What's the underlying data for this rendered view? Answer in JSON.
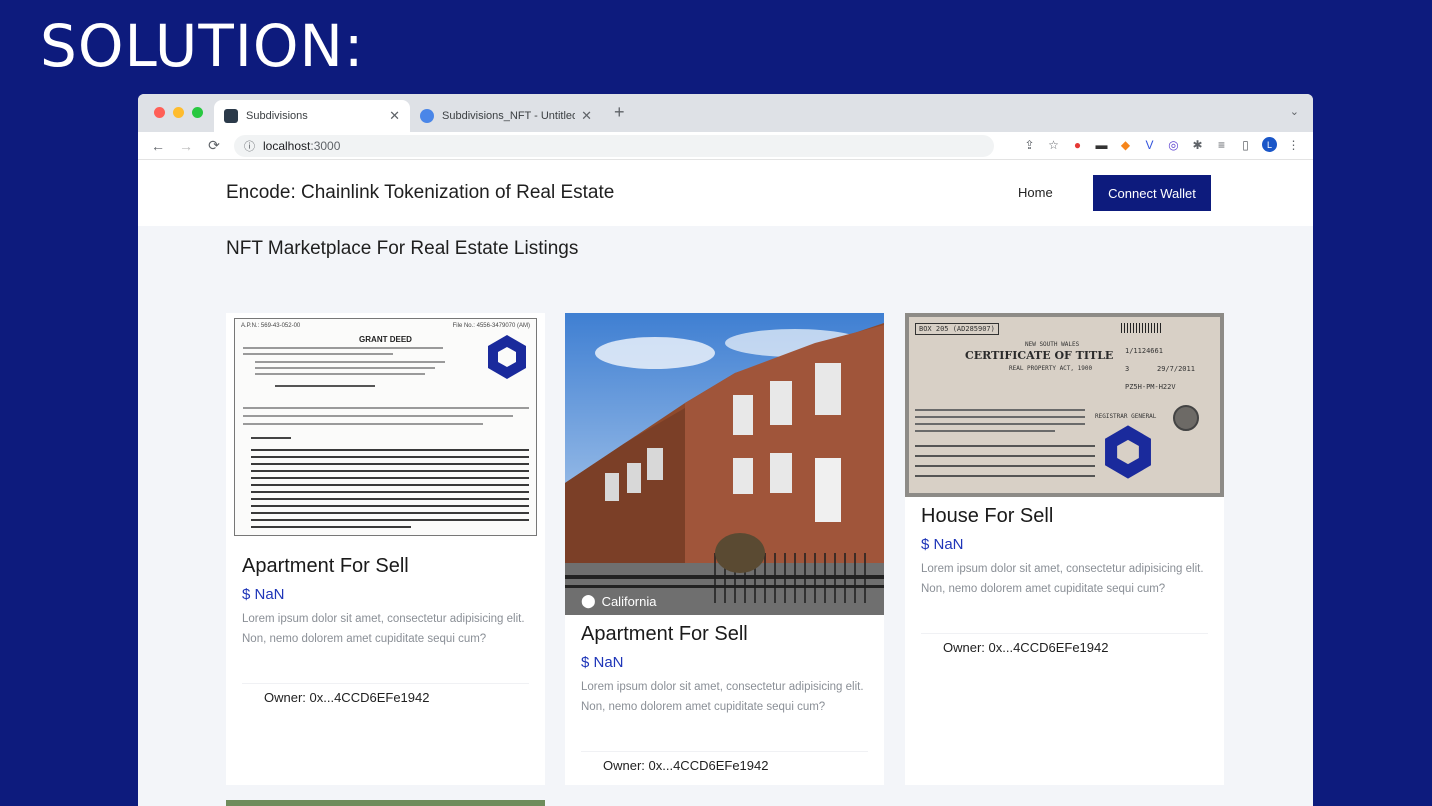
{
  "slide": {
    "title": "SOLUTION:"
  },
  "browser": {
    "tabs": [
      {
        "label": "Subdivisions",
        "active": true
      },
      {
        "label": "Subdivisions_NFT - Untitled C",
        "active": false
      }
    ],
    "tab_close_glyph": "✕",
    "new_tab_glyph": "+",
    "tab_menu_glyph": "⌄",
    "nav": {
      "back": "←",
      "forward": "→",
      "reload": "⟳"
    },
    "url": {
      "host": "localhost",
      "port": ":3000"
    },
    "extension_icons": [
      "share-icon",
      "star-icon",
      "extension-red-icon",
      "extension-dark-icon",
      "metamask-icon",
      "extension-v-icon",
      "extension-circle-icon",
      "puzzle-icon",
      "reading-list-icon",
      "sidepanel-icon",
      "profile-icon",
      "menu-icon"
    ]
  },
  "site": {
    "brand": "Encode: Chainlink Tokenization of Real Estate",
    "nav_home": "Home",
    "connect_button": "Connect Wallet",
    "page_heading": "NFT Marketplace For Real Estate Listings"
  },
  "deed": {
    "apn": "A.P.N.: 569-43-052-00",
    "file_no": "File No.: 4556-3479070 (AM)",
    "heading": "GRANT DEED"
  },
  "certificate": {
    "box": "BOX 205 (AD285907)",
    "state": "NEW SOUTH WALES",
    "title": "CERTIFICATE OF TITLE",
    "act": "REAL PROPERTY ACT, 1900",
    "folio": "1/1124661",
    "edition": "3",
    "date": "29/7/2011",
    "code": "PZ5H-PM-H22V",
    "registrar": "REGISTRAR GENERAL"
  },
  "listings": [
    {
      "title": "Apartment For Sell",
      "price": "$ NaN",
      "description": "Lorem ipsum dolor sit amet, consectetur adipisicing elit. Non, nemo dolorem amet cupiditate sequi cum?",
      "owner": "Owner: 0x...4CCD6EFe1942",
      "image": "grant-deed"
    },
    {
      "title": "Apartment For Sell",
      "price": "$ NaN",
      "description": "Lorem ipsum dolor sit amet, consectetur adipisicing elit. Non, nemo dolorem amet cupiditate sequi cum?",
      "owner": "Owner: 0x...4CCD6EFe1942",
      "location": "California",
      "image": "brick-house"
    },
    {
      "title": "House For Sell",
      "price": "$ NaN",
      "description": "Lorem ipsum dolor sit amet, consectetur adipisicing elit. Non, nemo dolorem amet cupiditate sequi cum?",
      "owner": "Owner: 0x...4CCD6EFe1942",
      "image": "certificate-of-title"
    }
  ],
  "colors": {
    "slide_bg": "#0d1b7d",
    "accent": "#0d1b7d",
    "price": "#1e35b8",
    "chainlink_blue": "#1a2a9c"
  }
}
